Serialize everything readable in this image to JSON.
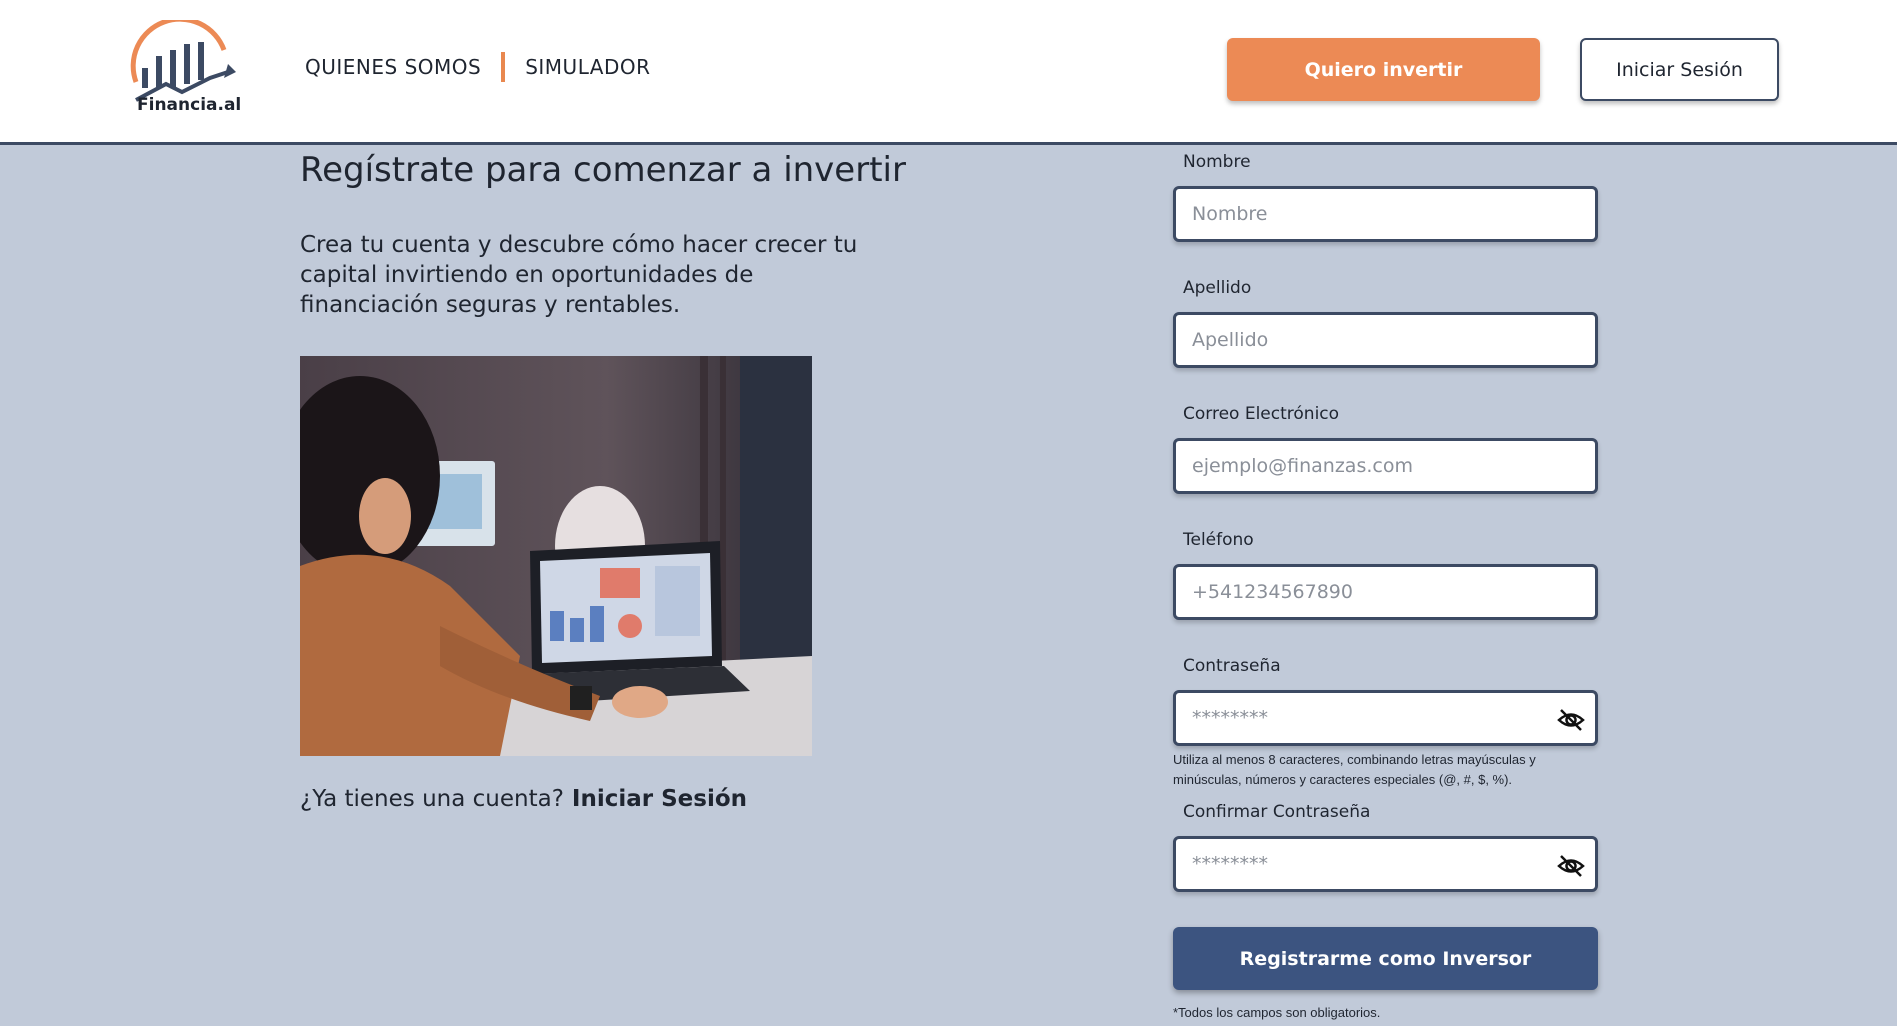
{
  "header": {
    "logo_text": "Financia.al",
    "nav": [
      {
        "label": "QUIENES SOMOS"
      },
      {
        "label": "SIMULADOR"
      }
    ],
    "invest_button": "Quiero invertir",
    "login_button": "Iniciar Sesión"
  },
  "intro": {
    "title": "Regístrate para comenzar a invertir",
    "subtitle": "Crea tu cuenta y descubre cómo hacer crecer tu capital invirtiendo en oportunidades de financiación seguras y rentables.",
    "account_question": "¿Ya tienes una cuenta?",
    "account_link": "Iniciar Sesión"
  },
  "form": {
    "fields": [
      {
        "label": "Nombre",
        "placeholder": "Nombre",
        "value": ""
      },
      {
        "label": "Apellido",
        "placeholder": "Apellido",
        "value": ""
      },
      {
        "label": "Correo Electrónico",
        "placeholder": "ejemplo@finanzas.com",
        "value": ""
      },
      {
        "label": "Teléfono",
        "placeholder": "+541234567890",
        "value": ""
      },
      {
        "label": "Contraseña",
        "placeholder": "********",
        "value": ""
      },
      {
        "label": "Confirmar Contraseña",
        "placeholder": "********",
        "value": ""
      }
    ],
    "password_hint": "Utiliza al menos 8 caracteres, combinando letras mayúsculas y minúsculas, números y caracteres especiales (@, #, $, %).",
    "submit_button": "Registrarme como Inversor",
    "required_note": "*Todos los campos son obligatorios."
  },
  "colors": {
    "accent_orange": "#ec8a55",
    "primary_navy": "#3c5480",
    "page_background": "#c1cad9"
  },
  "icons": {
    "password_toggle": "eye-slash-icon",
    "logo": "bar-chart-growth-icon"
  }
}
